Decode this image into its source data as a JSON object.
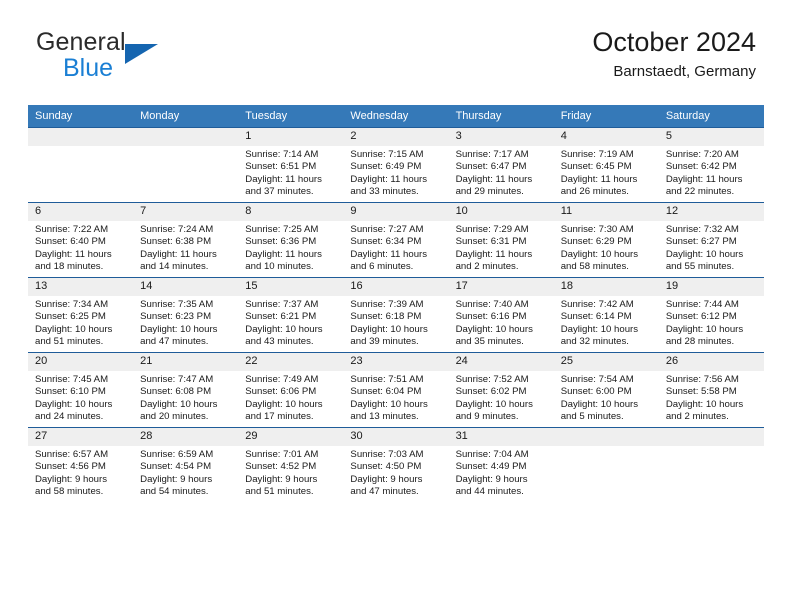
{
  "brand": {
    "name_top": "General",
    "name_bottom": "Blue",
    "triangle_color": "#1565b0",
    "blue_color": "#1a7fd4"
  },
  "header": {
    "title": "October 2024",
    "subtitle": "Barnstaedt, Germany",
    "header_bg": "#3579b8",
    "cell_border": "#1f5c99",
    "daynum_bg": "#efefef"
  },
  "weekdays": [
    "Sunday",
    "Monday",
    "Tuesday",
    "Wednesday",
    "Thursday",
    "Friday",
    "Saturday"
  ],
  "weeks": [
    [
      {
        "day": "",
        "empty": true,
        "sunrise": "",
        "sunset": "",
        "daylight_1": "",
        "daylight_2": ""
      },
      {
        "day": "",
        "empty": true,
        "sunrise": "",
        "sunset": "",
        "daylight_1": "",
        "daylight_2": ""
      },
      {
        "day": "1",
        "empty": false,
        "sunrise": "Sunrise: 7:14 AM",
        "sunset": "Sunset: 6:51 PM",
        "daylight_1": "Daylight: 11 hours",
        "daylight_2": "and 37 minutes."
      },
      {
        "day": "2",
        "empty": false,
        "sunrise": "Sunrise: 7:15 AM",
        "sunset": "Sunset: 6:49 PM",
        "daylight_1": "Daylight: 11 hours",
        "daylight_2": "and 33 minutes."
      },
      {
        "day": "3",
        "empty": false,
        "sunrise": "Sunrise: 7:17 AM",
        "sunset": "Sunset: 6:47 PM",
        "daylight_1": "Daylight: 11 hours",
        "daylight_2": "and 29 minutes."
      },
      {
        "day": "4",
        "empty": false,
        "sunrise": "Sunrise: 7:19 AM",
        "sunset": "Sunset: 6:45 PM",
        "daylight_1": "Daylight: 11 hours",
        "daylight_2": "and 26 minutes."
      },
      {
        "day": "5",
        "empty": false,
        "sunrise": "Sunrise: 7:20 AM",
        "sunset": "Sunset: 6:42 PM",
        "daylight_1": "Daylight: 11 hours",
        "daylight_2": "and 22 minutes."
      }
    ],
    [
      {
        "day": "6",
        "empty": false,
        "sunrise": "Sunrise: 7:22 AM",
        "sunset": "Sunset: 6:40 PM",
        "daylight_1": "Daylight: 11 hours",
        "daylight_2": "and 18 minutes."
      },
      {
        "day": "7",
        "empty": false,
        "sunrise": "Sunrise: 7:24 AM",
        "sunset": "Sunset: 6:38 PM",
        "daylight_1": "Daylight: 11 hours",
        "daylight_2": "and 14 minutes."
      },
      {
        "day": "8",
        "empty": false,
        "sunrise": "Sunrise: 7:25 AM",
        "sunset": "Sunset: 6:36 PM",
        "daylight_1": "Daylight: 11 hours",
        "daylight_2": "and 10 minutes."
      },
      {
        "day": "9",
        "empty": false,
        "sunrise": "Sunrise: 7:27 AM",
        "sunset": "Sunset: 6:34 PM",
        "daylight_1": "Daylight: 11 hours",
        "daylight_2": "and 6 minutes."
      },
      {
        "day": "10",
        "empty": false,
        "sunrise": "Sunrise: 7:29 AM",
        "sunset": "Sunset: 6:31 PM",
        "daylight_1": "Daylight: 11 hours",
        "daylight_2": "and 2 minutes."
      },
      {
        "day": "11",
        "empty": false,
        "sunrise": "Sunrise: 7:30 AM",
        "sunset": "Sunset: 6:29 PM",
        "daylight_1": "Daylight: 10 hours",
        "daylight_2": "and 58 minutes."
      },
      {
        "day": "12",
        "empty": false,
        "sunrise": "Sunrise: 7:32 AM",
        "sunset": "Sunset: 6:27 PM",
        "daylight_1": "Daylight: 10 hours",
        "daylight_2": "and 55 minutes."
      }
    ],
    [
      {
        "day": "13",
        "empty": false,
        "sunrise": "Sunrise: 7:34 AM",
        "sunset": "Sunset: 6:25 PM",
        "daylight_1": "Daylight: 10 hours",
        "daylight_2": "and 51 minutes."
      },
      {
        "day": "14",
        "empty": false,
        "sunrise": "Sunrise: 7:35 AM",
        "sunset": "Sunset: 6:23 PM",
        "daylight_1": "Daylight: 10 hours",
        "daylight_2": "and 47 minutes."
      },
      {
        "day": "15",
        "empty": false,
        "sunrise": "Sunrise: 7:37 AM",
        "sunset": "Sunset: 6:21 PM",
        "daylight_1": "Daylight: 10 hours",
        "daylight_2": "and 43 minutes."
      },
      {
        "day": "16",
        "empty": false,
        "sunrise": "Sunrise: 7:39 AM",
        "sunset": "Sunset: 6:18 PM",
        "daylight_1": "Daylight: 10 hours",
        "daylight_2": "and 39 minutes."
      },
      {
        "day": "17",
        "empty": false,
        "sunrise": "Sunrise: 7:40 AM",
        "sunset": "Sunset: 6:16 PM",
        "daylight_1": "Daylight: 10 hours",
        "daylight_2": "and 35 minutes."
      },
      {
        "day": "18",
        "empty": false,
        "sunrise": "Sunrise: 7:42 AM",
        "sunset": "Sunset: 6:14 PM",
        "daylight_1": "Daylight: 10 hours",
        "daylight_2": "and 32 minutes."
      },
      {
        "day": "19",
        "empty": false,
        "sunrise": "Sunrise: 7:44 AM",
        "sunset": "Sunset: 6:12 PM",
        "daylight_1": "Daylight: 10 hours",
        "daylight_2": "and 28 minutes."
      }
    ],
    [
      {
        "day": "20",
        "empty": false,
        "sunrise": "Sunrise: 7:45 AM",
        "sunset": "Sunset: 6:10 PM",
        "daylight_1": "Daylight: 10 hours",
        "daylight_2": "and 24 minutes."
      },
      {
        "day": "21",
        "empty": false,
        "sunrise": "Sunrise: 7:47 AM",
        "sunset": "Sunset: 6:08 PM",
        "daylight_1": "Daylight: 10 hours",
        "daylight_2": "and 20 minutes."
      },
      {
        "day": "22",
        "empty": false,
        "sunrise": "Sunrise: 7:49 AM",
        "sunset": "Sunset: 6:06 PM",
        "daylight_1": "Daylight: 10 hours",
        "daylight_2": "and 17 minutes."
      },
      {
        "day": "23",
        "empty": false,
        "sunrise": "Sunrise: 7:51 AM",
        "sunset": "Sunset: 6:04 PM",
        "daylight_1": "Daylight: 10 hours",
        "daylight_2": "and 13 minutes."
      },
      {
        "day": "24",
        "empty": false,
        "sunrise": "Sunrise: 7:52 AM",
        "sunset": "Sunset: 6:02 PM",
        "daylight_1": "Daylight: 10 hours",
        "daylight_2": "and 9 minutes."
      },
      {
        "day": "25",
        "empty": false,
        "sunrise": "Sunrise: 7:54 AM",
        "sunset": "Sunset: 6:00 PM",
        "daylight_1": "Daylight: 10 hours",
        "daylight_2": "and 5 minutes."
      },
      {
        "day": "26",
        "empty": false,
        "sunrise": "Sunrise: 7:56 AM",
        "sunset": "Sunset: 5:58 PM",
        "daylight_1": "Daylight: 10 hours",
        "daylight_2": "and 2 minutes."
      }
    ],
    [
      {
        "day": "27",
        "empty": false,
        "sunrise": "Sunrise: 6:57 AM",
        "sunset": "Sunset: 4:56 PM",
        "daylight_1": "Daylight: 9 hours",
        "daylight_2": "and 58 minutes."
      },
      {
        "day": "28",
        "empty": false,
        "sunrise": "Sunrise: 6:59 AM",
        "sunset": "Sunset: 4:54 PM",
        "daylight_1": "Daylight: 9 hours",
        "daylight_2": "and 54 minutes."
      },
      {
        "day": "29",
        "empty": false,
        "sunrise": "Sunrise: 7:01 AM",
        "sunset": "Sunset: 4:52 PM",
        "daylight_1": "Daylight: 9 hours",
        "daylight_2": "and 51 minutes."
      },
      {
        "day": "30",
        "empty": false,
        "sunrise": "Sunrise: 7:03 AM",
        "sunset": "Sunset: 4:50 PM",
        "daylight_1": "Daylight: 9 hours",
        "daylight_2": "and 47 minutes."
      },
      {
        "day": "31",
        "empty": false,
        "sunrise": "Sunrise: 7:04 AM",
        "sunset": "Sunset: 4:49 PM",
        "daylight_1": "Daylight: 9 hours",
        "daylight_2": "and 44 minutes."
      },
      {
        "day": "",
        "empty": true,
        "sunrise": "",
        "sunset": "",
        "daylight_1": "",
        "daylight_2": ""
      },
      {
        "day": "",
        "empty": true,
        "sunrise": "",
        "sunset": "",
        "daylight_1": "",
        "daylight_2": ""
      }
    ]
  ]
}
